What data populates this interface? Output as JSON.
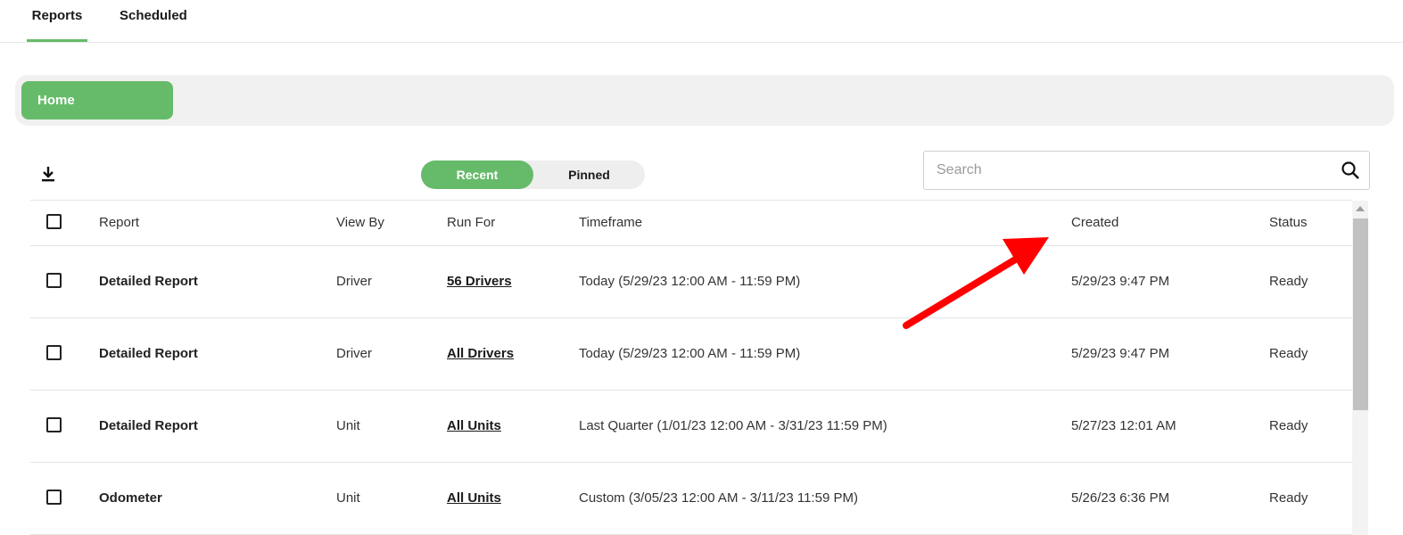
{
  "tabs": [
    {
      "label": "Reports",
      "active": true
    },
    {
      "label": "Scheduled",
      "active": false
    }
  ],
  "breadcrumb": {
    "home": "Home"
  },
  "toolbar": {
    "download_icon": "download-icon",
    "segments": [
      {
        "label": "Recent",
        "active": true
      },
      {
        "label": "Pinned",
        "active": false
      }
    ],
    "search": {
      "placeholder": "Search",
      "value": "",
      "icon": "search-icon"
    }
  },
  "table": {
    "headers": {
      "report": "Report",
      "view_by": "View By",
      "run_for": "Run For",
      "timeframe": "Timeframe",
      "created": "Created",
      "status": "Status"
    },
    "rows": [
      {
        "report": "Detailed Report",
        "view_by": "Driver",
        "run_for": "56 Drivers",
        "timeframe": "Today (5/29/23 12:00 AM - 11:59 PM)",
        "created": "5/29/23 9:47 PM",
        "status": "Ready"
      },
      {
        "report": "Detailed Report",
        "view_by": "Driver",
        "run_for": "All Drivers",
        "timeframe": "Today (5/29/23 12:00 AM - 11:59 PM)",
        "created": "5/29/23 9:47 PM",
        "status": "Ready"
      },
      {
        "report": "Detailed Report",
        "view_by": "Unit",
        "run_for": "All Units",
        "timeframe": "Last Quarter (1/01/23 12:00 AM - 3/31/23 11:59 PM)",
        "created": "5/27/23 12:01 AM",
        "status": "Ready"
      },
      {
        "report": "Odometer",
        "view_by": "Unit",
        "run_for": "All Units",
        "timeframe": "Custom (3/05/23 12:00 AM - 3/11/23 11:59 PM)",
        "created": "5/26/23 6:36 PM",
        "status": "Ready"
      }
    ]
  },
  "colors": {
    "accent": "#66bb6a",
    "annotation": "#ff0000"
  }
}
